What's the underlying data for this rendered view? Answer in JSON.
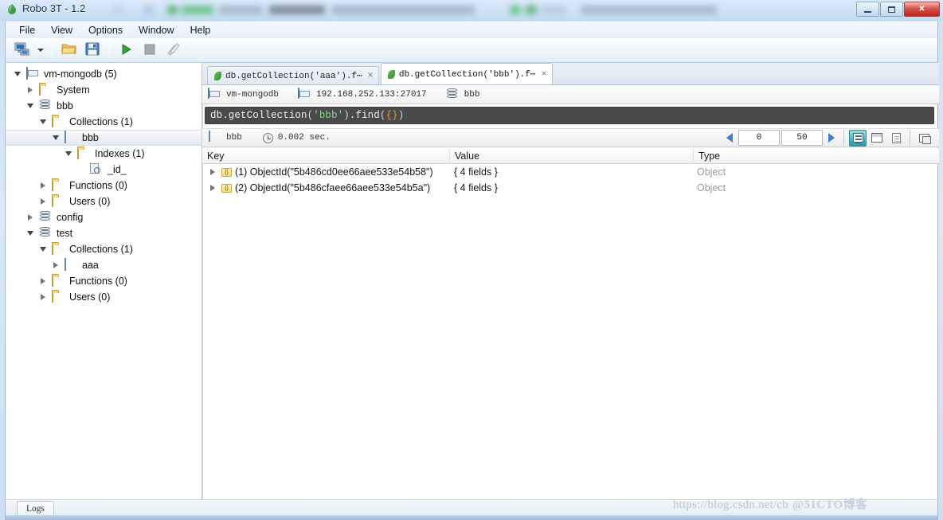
{
  "window": {
    "title": "Robo 3T - 1.2",
    "app_icon": "leaf-icon",
    "controls": {
      "minimize": "minimize",
      "maximize": "maximize",
      "close": "close"
    }
  },
  "menubar": {
    "items": [
      {
        "label": "File",
        "name": "menu-file"
      },
      {
        "label": "View",
        "name": "menu-view"
      },
      {
        "label": "Options",
        "name": "menu-options"
      },
      {
        "label": "Window",
        "name": "menu-window"
      },
      {
        "label": "Help",
        "name": "menu-help"
      }
    ]
  },
  "toolbar": {
    "buttons": [
      {
        "name": "connect-button",
        "icon": "computer-connect-icon",
        "tooltip": "Connect"
      },
      {
        "name": "connect-dropdown",
        "icon": "chevron-down-icon",
        "tooltip": "Connections"
      },
      {
        "name": "open-script-button",
        "icon": "folder-open-icon",
        "tooltip": "Open Script"
      },
      {
        "name": "save-script-button",
        "icon": "floppy-save-icon",
        "tooltip": "Save Script"
      },
      {
        "name": "execute-button",
        "icon": "play-icon",
        "tooltip": "Execute"
      },
      {
        "name": "stop-button",
        "icon": "stop-square-icon",
        "tooltip": "Stop"
      },
      {
        "name": "refresh-button",
        "icon": "pencils-icon",
        "tooltip": "Refresh"
      }
    ]
  },
  "sidebar": {
    "tree": [
      {
        "label": "vm-mongodb (5)",
        "icon": "server-icon",
        "indent": 0,
        "twisty": "open",
        "selected": false,
        "name": "tree-item-connection"
      },
      {
        "label": "System",
        "icon": "folder-icon",
        "indent": 1,
        "twisty": "closed",
        "selected": false,
        "name": "tree-item-system"
      },
      {
        "label": "bbb",
        "icon": "database-icon",
        "indent": 1,
        "twisty": "open",
        "selected": false,
        "name": "tree-item-db-bbb"
      },
      {
        "label": "Collections (1)",
        "icon": "folder-icon",
        "indent": 2,
        "twisty": "open",
        "selected": false,
        "name": "tree-item-collections-bbb"
      },
      {
        "label": "bbb",
        "icon": "collection-icon",
        "indent": 3,
        "twisty": "open",
        "selected": true,
        "name": "tree-item-collection-bbb"
      },
      {
        "label": "Indexes (1)",
        "icon": "folder-icon",
        "indent": 4,
        "twisty": "open",
        "selected": false,
        "name": "tree-item-indexes"
      },
      {
        "label": "_id_",
        "icon": "index-icon",
        "indent": 5,
        "twisty": "none",
        "selected": false,
        "name": "tree-item-index-id"
      },
      {
        "label": "Functions (0)",
        "icon": "folder-icon",
        "indent": 2,
        "twisty": "closed",
        "selected": false,
        "name": "tree-item-functions-bbb"
      },
      {
        "label": "Users (0)",
        "icon": "folder-icon",
        "indent": 2,
        "twisty": "closed",
        "selected": false,
        "name": "tree-item-users-bbb"
      },
      {
        "label": "config",
        "icon": "database-icon",
        "indent": 1,
        "twisty": "closed",
        "selected": false,
        "name": "tree-item-db-config"
      },
      {
        "label": "test",
        "icon": "database-icon",
        "indent": 1,
        "twisty": "open",
        "selected": false,
        "name": "tree-item-db-test"
      },
      {
        "label": "Collections (1)",
        "icon": "folder-icon",
        "indent": 2,
        "twisty": "open",
        "selected": false,
        "name": "tree-item-collections-test"
      },
      {
        "label": "aaa",
        "icon": "collection-icon",
        "indent": 3,
        "twisty": "closed",
        "selected": false,
        "name": "tree-item-collection-aaa"
      },
      {
        "label": "Functions (0)",
        "icon": "folder-icon",
        "indent": 2,
        "twisty": "closed",
        "selected": false,
        "name": "tree-item-functions-test"
      },
      {
        "label": "Users (0)",
        "icon": "folder-icon",
        "indent": 2,
        "twisty": "closed",
        "selected": false,
        "name": "tree-item-users-test"
      }
    ]
  },
  "tabs": [
    {
      "label": "db.getCollection('aaa').f⋯",
      "active": false,
      "icon": "leaf-icon",
      "close": "×",
      "name": "tab-query-aaa"
    },
    {
      "label": "db.getCollection('bbb').f⋯",
      "active": true,
      "icon": "leaf-icon",
      "close": "×",
      "name": "tab-query-bbb"
    }
  ],
  "connection_bar": {
    "server": "vm-mongodb",
    "address": "192.168.252.133:27017",
    "database": "bbb"
  },
  "editor": {
    "tokens": [
      {
        "text": "db.getCollection",
        "cls": "t-plain"
      },
      {
        "text": "(",
        "cls": "t-paren"
      },
      {
        "text": "'bbb'",
        "cls": "t-str"
      },
      {
        "text": ")",
        "cls": "t-paren"
      },
      {
        "text": ".find",
        "cls": "t-plain"
      },
      {
        "text": "(",
        "cls": "t-paren"
      },
      {
        "text": "{}",
        "cls": "t-brace"
      },
      {
        "text": ")",
        "cls": "t-paren"
      }
    ],
    "full_text": "db.getCollection('bbb').find({})"
  },
  "results_bar": {
    "collection": "bbb",
    "time_icon": "clock-icon",
    "time": "0.002 sec.",
    "pager": {
      "skip": "0",
      "limit": "50",
      "prev_icon": "left-arrow-icon",
      "next_icon": "right-arrow-icon"
    },
    "view_modes": [
      {
        "name": "tree-view-button",
        "icon": "tree-view-icon",
        "active": true
      },
      {
        "name": "table-view-button",
        "icon": "table-view-icon",
        "active": false
      },
      {
        "name": "text-view-button",
        "icon": "document-view-icon",
        "active": false
      },
      {
        "name": "maximize-results-button",
        "icon": "window-icon",
        "active": false
      }
    ]
  },
  "results_table": {
    "columns": [
      "Key",
      "Value",
      "Type"
    ],
    "rows": [
      {
        "key": "(1) ObjectId(\"5b486cd0ee66aee533e54b58\")",
        "value": "{ 4 fields }",
        "type": "Object",
        "icon": "objectid-icon",
        "twisty": "closed"
      },
      {
        "key": "(2) ObjectId(\"5b486cfaee66aee533e54b5a\")",
        "value": "{ 4 fields }",
        "type": "Object",
        "icon": "objectid-icon",
        "twisty": "closed"
      }
    ]
  },
  "bottom": {
    "logs_tab": "Logs"
  },
  "watermark": {
    "url": "https://blog.csdn.net/cb",
    "overlay": "@51CTO博客"
  },
  "colors": {
    "accent_selected_view": "#49b3c0",
    "editor_bg": "#4a4a4a",
    "string_token": "#7fe07f",
    "brace_token": "#e0a03c",
    "titlebar": "#cfe2f6",
    "close_button": "#d9534a"
  }
}
